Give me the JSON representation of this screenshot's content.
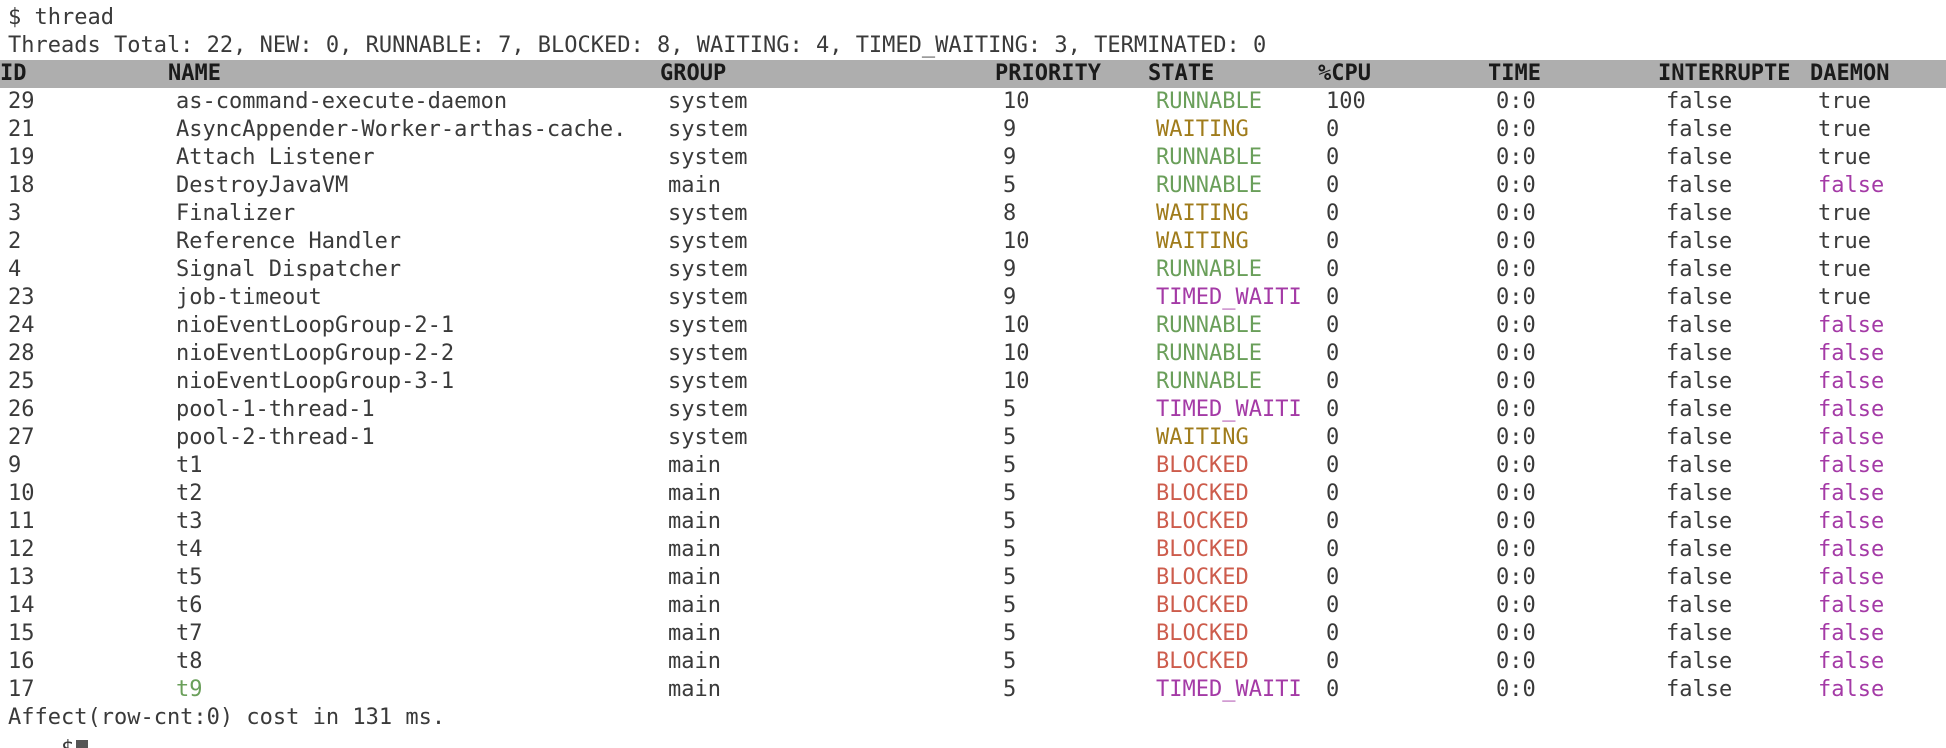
{
  "prompt_line": "$ thread",
  "summary": "Threads Total: 22, NEW: 0, RUNNABLE: 7, BLOCKED: 8, WAITING: 4, TIMED_WAITING: 3, TERMINATED: 0",
  "columns": [
    "ID",
    "NAME",
    "GROUP",
    "PRIORITY",
    "STATE",
    "%CPU",
    "TIME",
    "INTERRUPTE",
    "DAEMON"
  ],
  "rows": [
    {
      "id": "29",
      "name": "as-command-execute-daemon",
      "group": "system",
      "priority": "10",
      "state": "RUNNABLE",
      "cpu": "100",
      "time": "0:0",
      "interrupted": "false",
      "daemon": "true"
    },
    {
      "id": "21",
      "name": "AsyncAppender-Worker-arthas-cache.",
      "group": "system",
      "priority": "9",
      "state": "WAITING",
      "cpu": "0",
      "time": "0:0",
      "interrupted": "false",
      "daemon": "true"
    },
    {
      "id": "19",
      "name": "Attach Listener",
      "group": "system",
      "priority": "9",
      "state": "RUNNABLE",
      "cpu": "0",
      "time": "0:0",
      "interrupted": "false",
      "daemon": "true"
    },
    {
      "id": "18",
      "name": "DestroyJavaVM",
      "group": "main",
      "priority": "5",
      "state": "RUNNABLE",
      "cpu": "0",
      "time": "0:0",
      "interrupted": "false",
      "daemon": "false"
    },
    {
      "id": "3",
      "name": "Finalizer",
      "group": "system",
      "priority": "8",
      "state": "WAITING",
      "cpu": "0",
      "time": "0:0",
      "interrupted": "false",
      "daemon": "true"
    },
    {
      "id": "2",
      "name": "Reference Handler",
      "group": "system",
      "priority": "10",
      "state": "WAITING",
      "cpu": "0",
      "time": "0:0",
      "interrupted": "false",
      "daemon": "true"
    },
    {
      "id": "4",
      "name": "Signal Dispatcher",
      "group": "system",
      "priority": "9",
      "state": "RUNNABLE",
      "cpu": "0",
      "time": "0:0",
      "interrupted": "false",
      "daemon": "true"
    },
    {
      "id": "23",
      "name": "job-timeout",
      "group": "system",
      "priority": "9",
      "state": "TIMED_WAITI",
      "cpu": "0",
      "time": "0:0",
      "interrupted": "false",
      "daemon": "true"
    },
    {
      "id": "24",
      "name": "nioEventLoopGroup-2-1",
      "group": "system",
      "priority": "10",
      "state": "RUNNABLE",
      "cpu": "0",
      "time": "0:0",
      "interrupted": "false",
      "daemon": "false"
    },
    {
      "id": "28",
      "name": "nioEventLoopGroup-2-2",
      "group": "system",
      "priority": "10",
      "state": "RUNNABLE",
      "cpu": "0",
      "time": "0:0",
      "interrupted": "false",
      "daemon": "false"
    },
    {
      "id": "25",
      "name": "nioEventLoopGroup-3-1",
      "group": "system",
      "priority": "10",
      "state": "RUNNABLE",
      "cpu": "0",
      "time": "0:0",
      "interrupted": "false",
      "daemon": "false"
    },
    {
      "id": "26",
      "name": "pool-1-thread-1",
      "group": "system",
      "priority": "5",
      "state": "TIMED_WAITI",
      "cpu": "0",
      "time": "0:0",
      "interrupted": "false",
      "daemon": "false"
    },
    {
      "id": "27",
      "name": "pool-2-thread-1",
      "group": "system",
      "priority": "5",
      "state": "WAITING",
      "cpu": "0",
      "time": "0:0",
      "interrupted": "false",
      "daemon": "false"
    },
    {
      "id": "9",
      "name": "t1",
      "group": "main",
      "priority": "5",
      "state": "BLOCKED",
      "cpu": "0",
      "time": "0:0",
      "interrupted": "false",
      "daemon": "false"
    },
    {
      "id": "10",
      "name": "t2",
      "group": "main",
      "priority": "5",
      "state": "BLOCKED",
      "cpu": "0",
      "time": "0:0",
      "interrupted": "false",
      "daemon": "false"
    },
    {
      "id": "11",
      "name": "t3",
      "group": "main",
      "priority": "5",
      "state": "BLOCKED",
      "cpu": "0",
      "time": "0:0",
      "interrupted": "false",
      "daemon": "false"
    },
    {
      "id": "12",
      "name": "t4",
      "group": "main",
      "priority": "5",
      "state": "BLOCKED",
      "cpu": "0",
      "time": "0:0",
      "interrupted": "false",
      "daemon": "false"
    },
    {
      "id": "13",
      "name": "t5",
      "group": "main",
      "priority": "5",
      "state": "BLOCKED",
      "cpu": "0",
      "time": "0:0",
      "interrupted": "false",
      "daemon": "false"
    },
    {
      "id": "14",
      "name": "t6",
      "group": "main",
      "priority": "5",
      "state": "BLOCKED",
      "cpu": "0",
      "time": "0:0",
      "interrupted": "false",
      "daemon": "false"
    },
    {
      "id": "15",
      "name": "t7",
      "group": "main",
      "priority": "5",
      "state": "BLOCKED",
      "cpu": "0",
      "time": "0:0",
      "interrupted": "false",
      "daemon": "false"
    },
    {
      "id": "16",
      "name": "t8",
      "group": "main",
      "priority": "5",
      "state": "BLOCKED",
      "cpu": "0",
      "time": "0:0",
      "interrupted": "false",
      "daemon": "false"
    },
    {
      "id": "17",
      "name": "t9",
      "group": "main",
      "priority": "5",
      "state": "TIMED_WAITI",
      "cpu": "0",
      "time": "0:0",
      "interrupted": "false",
      "daemon": "false",
      "highlight_name": true
    }
  ],
  "footer": "Affect(row-cnt:0) cost in 131 ms.",
  "prompt_char": "$",
  "colors": {
    "header_bg": "#aeaeae",
    "runnable": "#6a9f5a",
    "waiting": "#a07c1c",
    "timed_waiting": "#a43aa6",
    "blocked": "#cd5c4c",
    "daemon_false": "#a43aa6"
  }
}
